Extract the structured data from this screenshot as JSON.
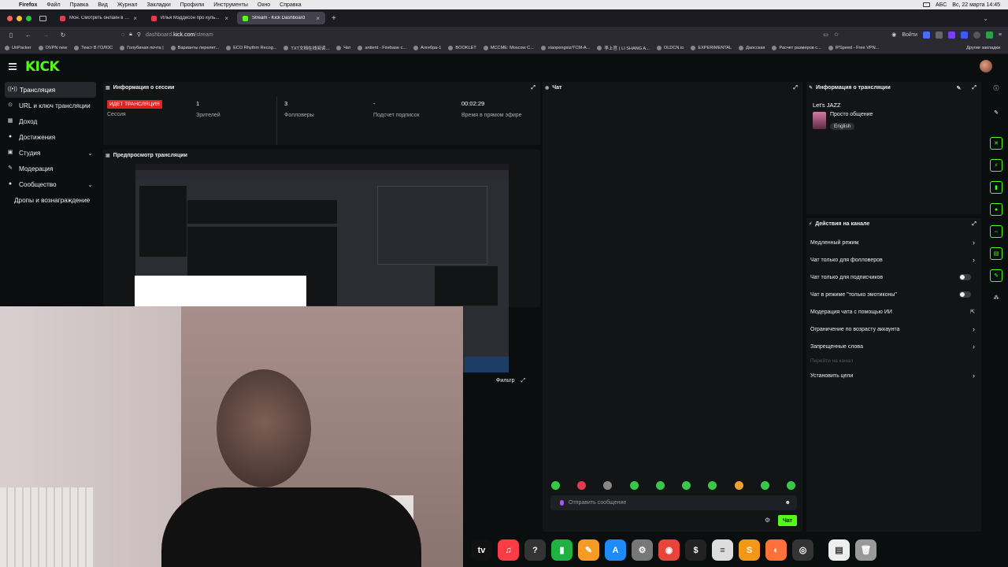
{
  "menubar": {
    "app": "Firefox",
    "items": [
      "Файл",
      "Правка",
      "Вид",
      "Журнал",
      "Закладки",
      "Профили",
      "Инструменты",
      "Окно",
      "Справка"
    ],
    "kbd": "АБС",
    "datetime": "Вс, 22 марта  14:45"
  },
  "tabs": [
    {
      "label": "Мон. Смотреть онлайн в хоро",
      "color": "#e23b4d"
    },
    {
      "label": "Илья Мэддисон про культуру",
      "color": "#e23b4d"
    },
    {
      "label": "Stream - Kick Dashboard",
      "color": "#53fc18",
      "active": true
    }
  ],
  "url": {
    "host_pre": "dashboard.",
    "host": "kick.com",
    "path": "/stream"
  },
  "nav_login": "Войти",
  "bookmarks": [
    "UnPacker",
    "OVPN new",
    "Текст В ГОЛОС",
    "Голубиная почта |",
    "Варианты перелет...",
    "ECO Rhythm Recog...",
    "TXT文档在线阅读...",
    "Чат",
    "antient - Firebase c...",
    "Алгебра-1",
    "BOOKLET",
    "MCCME: Moscow C...",
    "xiaopengxiz/TCM-A...",
    "李上官 ( LI SHANG A...",
    "OLDCN.io",
    "EXPERIMENTAL",
    "Даосская",
    "Расчет размеров с...",
    "IPSpeed - Free VPN..."
  ],
  "bookmarks_other": "Другие закладки",
  "logo": "KICK",
  "sidebar": [
    {
      "label": "Трансляция",
      "icon": "broadcast-icon",
      "glyph": "((•))",
      "active": true
    },
    {
      "label": "URL и ключ трансляции",
      "icon": "key-icon",
      "glyph": "⊙"
    },
    {
      "label": "Доход",
      "icon": "income-icon",
      "glyph": "▦"
    },
    {
      "label": "Достижения",
      "icon": "trophy-icon",
      "glyph": "●"
    },
    {
      "label": "Студия",
      "icon": "studio-icon",
      "glyph": "▣",
      "chevron": true
    },
    {
      "label": "Модерация",
      "icon": "wrench-icon",
      "glyph": "✎"
    },
    {
      "label": "Сообщество",
      "icon": "community-icon",
      "glyph": "●",
      "chevron": true
    },
    {
      "label": "Дропы и вознаграждение",
      "sub": true
    }
  ],
  "session": {
    "title": "Информация о сессии",
    "live_badge": "ИДЕТ ТРАНСЛЯЦИЯ",
    "session_label": "Сессия",
    "viewers": "1",
    "viewers_label": "Зрителей",
    "followers": "3",
    "followers_label": "Фолловеры",
    "subs": "-",
    "subs_label": "Подсчет подписок",
    "uptime": "00:02:29",
    "uptime_label": "Время в прямом эфире"
  },
  "preview": {
    "title": "Предпросмотр трансляции",
    "filter": "Фильтр"
  },
  "chat": {
    "title": "Чат",
    "placeholder": "Отправить сообщение",
    "send": "Чат"
  },
  "info": {
    "title": "Информация о трансляции",
    "stream_title": "Let's JAZZ",
    "category": "Просто общение",
    "language": "English"
  },
  "actions": {
    "title": "Действия на канале",
    "items": [
      {
        "label": "Медленный режим",
        "kind": "arrow"
      },
      {
        "label": "Чат только для фолловеров",
        "kind": "arrow"
      },
      {
        "label": "Чат только для подписчиков",
        "kind": "toggle"
      },
      {
        "label": "Чат в режиме \"только эмотиконы\"",
        "kind": "toggle"
      },
      {
        "label": "Модерация чата с помощью ИИ",
        "kind": "external"
      },
      {
        "label": "Ограничение по возрасту аккаунта",
        "kind": "arrow"
      },
      {
        "label": "Запрещенные слова",
        "kind": "arrow"
      },
      {
        "label": "Перейти на канал",
        "kind": "dim"
      },
      {
        "label": "Установить цели",
        "kind": "arrow"
      }
    ]
  },
  "dock": [
    {
      "name": "apple-tv-icon",
      "glyph": "tv",
      "color": "#111"
    },
    {
      "name": "music-icon",
      "glyph": "♫",
      "color": "#fc3c44"
    },
    {
      "name": "help-icon",
      "glyph": "?",
      "color": "#333"
    },
    {
      "name": "numbers-icon",
      "glyph": "▮",
      "color": "#1fb141"
    },
    {
      "name": "pages-icon",
      "glyph": "✎",
      "color": "#f59a23"
    },
    {
      "name": "app-store-icon",
      "glyph": "A",
      "color": "#1d8cf8"
    },
    {
      "name": "system-settings-icon",
      "glyph": "⚙",
      "color": "#777"
    },
    {
      "name": "chrome-icon",
      "glyph": "◉",
      "color": "#e9443a"
    },
    {
      "name": "terminal-icon",
      "glyph": "$",
      "color": "#222"
    },
    {
      "name": "textedit-icon",
      "glyph": "≡",
      "color": "#ddd"
    },
    {
      "name": "sublime-icon",
      "glyph": "S",
      "color": "#f29718"
    },
    {
      "name": "firefox-icon",
      "glyph": "◐",
      "color": "#ff7139"
    },
    {
      "name": "obs-icon",
      "glyph": "◎",
      "color": "#333"
    },
    {
      "name": "document-icon",
      "glyph": "▤",
      "color": "#eee"
    },
    {
      "name": "trash-icon",
      "glyph": "🗑",
      "color": "#999"
    }
  ]
}
